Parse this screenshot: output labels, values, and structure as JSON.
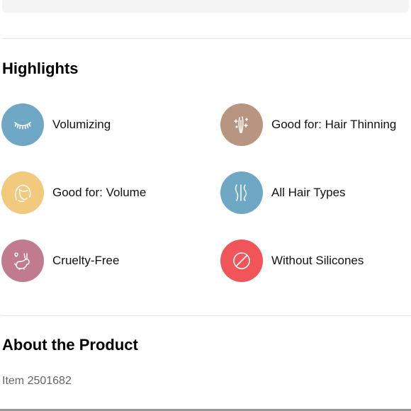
{
  "highlights": {
    "title": "Highlights",
    "items": [
      {
        "label": "Volumizing",
        "icon": "eyelash-icon",
        "color": "#6fa8c4"
      },
      {
        "label": "Good for: Hair Thinning",
        "icon": "hair-strand-sparkle-icon",
        "color": "#b89580"
      },
      {
        "label": "Good for: Volume",
        "icon": "hair-volume-head-icon",
        "color": "#f3c97d"
      },
      {
        "label": "All Hair Types",
        "icon": "wavy-hair-icon",
        "color": "#6fa8c4"
      },
      {
        "label": "Cruelty-Free",
        "icon": "bunny-heart-icon",
        "color": "#c07c8e"
      },
      {
        "label": "Without Silicones",
        "icon": "prohibited-icon",
        "color": "#f0555a"
      }
    ]
  },
  "about": {
    "title": "About the Product",
    "item_number": "Item 2501682"
  }
}
